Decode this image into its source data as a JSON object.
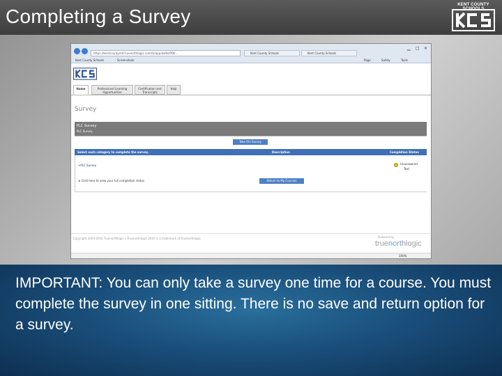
{
  "slide": {
    "title": "Completing a Survey",
    "logo": {
      "caption": "KENT COUNTY SCHOOLS",
      "letters": "KCS",
      "icon": "kcs-logo-icon"
    },
    "note": "IMPORTANT: You can only take a survey one time for a course. You must complete the survey in one sitting. There is no save and return option for a survey."
  },
  "browser": {
    "address": "https://kentcountymd.truenorthlogic.com/ia/app/webs/PDI/...",
    "tabs": [
      "Kent County Schools",
      "Kent County Schools"
    ],
    "favorites": [
      "Kent County Schools",
      "Screenshots"
    ],
    "tools": [
      "Page",
      "Safety",
      "Tools"
    ],
    "site_tabs": [
      {
        "label": "Home",
        "active": true
      },
      {
        "label": "Professional Learning Opportunities",
        "active": false
      },
      {
        "label": "Certification and Transcripts",
        "active": false
      },
      {
        "label": "Help",
        "active": false
      }
    ],
    "page_heading": "Survey",
    "survey_box": {
      "title": "PLC Survey",
      "subtitle": "PLC Survey"
    },
    "take_survey_button": "Take the Survey",
    "table": {
      "headers": [
        "Select each category to complete the survey.",
        "Description",
        "Completion Status"
      ],
      "row_label": "+PLC Survey",
      "status": "Unanswered",
      "status_sub": "Text"
    },
    "full_status_link": "⊕ Click here to view your full completion status",
    "return_button": "Return to My Courses",
    "footer": "Copyright 2003-2016 Truenorthlogic  •  Truenorthlogic 2016 is a trademark of Truenorthlogic",
    "powered_by": "Powered by",
    "brand": {
      "part1": "true",
      "part2": "north",
      "part3": "logic"
    },
    "zoom": "100%",
    "colors": {
      "accent": "#3f6fb6",
      "status": "#e4c22c"
    }
  }
}
